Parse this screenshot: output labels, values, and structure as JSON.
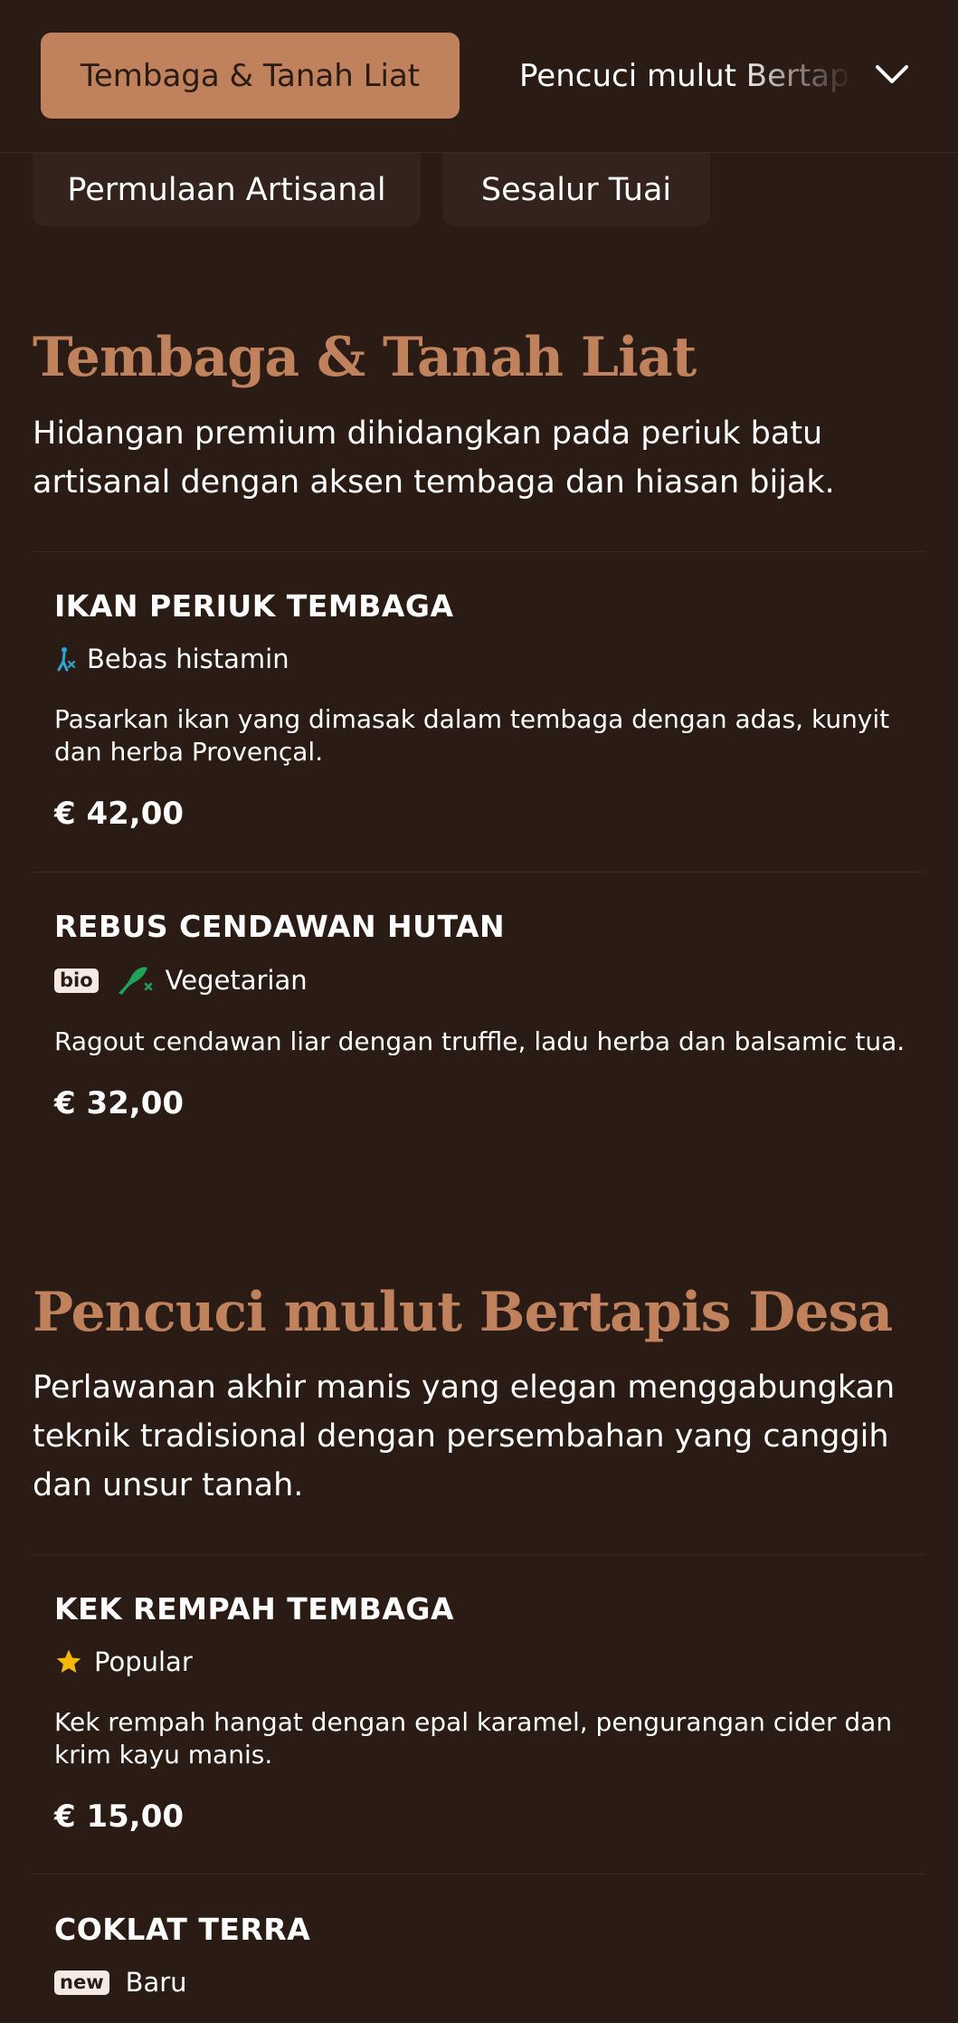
{
  "top_nav": {
    "active_category": "Tembaga & Tanah Liat",
    "next_category": "Pencuci mulut Bertapis Desa",
    "other_categories": [
      "Permulaan Artisanal",
      "Sesalur Tuai"
    ],
    "expand_icon": "chevron-down-icon"
  },
  "sections": [
    {
      "title": "Tembaga & Tanah Liat",
      "description": "Hidangan premium dihidangkan pada periuk batu artisanal dengan aksen tembaga dan hiasan bijak.",
      "items": [
        {
          "name": "IKAN PERIUK TEMBAGA",
          "tag_icon": "histamine-free-icon",
          "tag": "Bebas histamin",
          "description": "Pasarkan ikan yang dimasak dalam tembaga dengan adas, kunyit dan herba Provençal.",
          "price": "€ 42,00"
        },
        {
          "name": "REBUS CENDAWAN HUTAN",
          "badge": "bio",
          "tag_icon": "vegetarian-icon",
          "tag": "Vegetarian",
          "description": "Ragout cendawan liar dengan truffle, ladu herba dan balsamic tua.",
          "price": "€ 32,00"
        }
      ]
    },
    {
      "title": "Pencuci mulut Bertapis Desa",
      "description": "Perlawanan akhir manis yang elegan menggabungkan teknik tradisional dengan persembahan yang canggih dan unsur tanah.",
      "items": [
        {
          "name": "KEK REMPAH TEMBAGA",
          "tag_icon": "star-icon",
          "tag": "Popular",
          "description": "Kek rempah hangat dengan epal karamel, pengurangan cider dan krim kayu manis.",
          "price": "€ 15,00"
        },
        {
          "name": "COKLAT TERRA",
          "badge": "new",
          "tag": "Baru"
        }
      ]
    }
  ],
  "colors": {
    "background": "#2b1b15",
    "accent": "#c0825c",
    "pill": "#33231c",
    "star": "#f5b800",
    "vegetarian": "#1fa35b",
    "histamine": "#2aa7d6"
  }
}
